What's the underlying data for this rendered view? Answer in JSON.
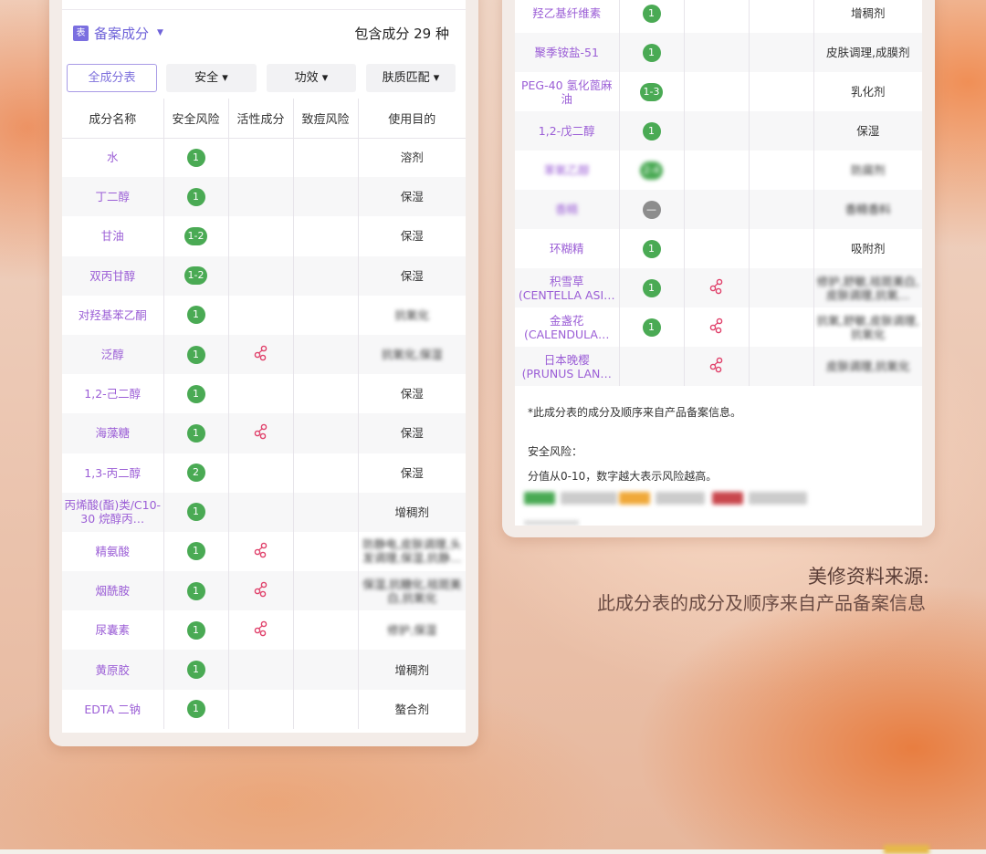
{
  "left": {
    "header": {
      "icon_label": "表",
      "title": "备案成分",
      "count_text": "包含成分 29 种"
    },
    "filters": [
      "全成分表",
      "安全 ▾",
      "功效 ▾",
      "肤质匹配 ▾"
    ],
    "columns": [
      "成分名称",
      "安全风险",
      "活性成分",
      "致痘风险",
      "使用目的"
    ],
    "rows": [
      {
        "name": "水",
        "risk": "1",
        "active": false,
        "purpose": "溶剂"
      },
      {
        "name": "丁二醇",
        "risk": "1",
        "active": false,
        "purpose": "保湿"
      },
      {
        "name": "甘油",
        "risk": "1-2",
        "active": false,
        "purpose": "保湿"
      },
      {
        "name": "双丙甘醇",
        "risk": "1-2",
        "active": false,
        "purpose": "保湿"
      },
      {
        "name": "对羟基苯乙酮",
        "risk": "1",
        "active": false,
        "purpose": "抗氧化"
      },
      {
        "name": "泛醇",
        "risk": "1",
        "active": true,
        "purpose": "抗氧化,保湿"
      },
      {
        "name": "1,2-己二醇",
        "risk": "1",
        "active": false,
        "purpose": "保湿"
      },
      {
        "name": "海藻糖",
        "risk": "1",
        "active": true,
        "purpose": "保湿"
      },
      {
        "name": "1,3-丙二醇",
        "risk": "2",
        "active": false,
        "purpose": "保湿"
      },
      {
        "name": "丙烯酸(酯)类/C10-30 烷醇丙…",
        "risk": "1",
        "active": false,
        "purpose": "增稠剂"
      },
      {
        "name": "精氨酸",
        "risk": "1",
        "active": true,
        "purpose": "防静电,皮肤调理,头发调理,保湿,抗静…"
      },
      {
        "name": "烟酰胺",
        "risk": "1",
        "active": true,
        "purpose": "保湿,抗糖化,祛斑美白,抗氧化"
      },
      {
        "name": "尿囊素",
        "risk": "1",
        "active": true,
        "purpose": "修护,保湿"
      },
      {
        "name": "黄原胶",
        "risk": "1",
        "active": false,
        "purpose": "增稠剂"
      },
      {
        "name": "EDTA 二钠",
        "risk": "1",
        "active": false,
        "purpose": "螯合剂"
      }
    ]
  },
  "right": {
    "rows": [
      {
        "name": "羟乙基纤维素",
        "risk": "1",
        "active": false,
        "purpose": "增稠剂"
      },
      {
        "name": "聚季铵盐-51",
        "risk": "1",
        "active": false,
        "purpose": "皮肤调理,成膜剂"
      },
      {
        "name": "PEG-40 氢化蓖麻油",
        "risk": "1-3",
        "active": false,
        "purpose": "乳化剂"
      },
      {
        "name": "1,2-戊二醇",
        "risk": "1",
        "active": false,
        "purpose": "保湿"
      },
      {
        "name": "苯氧乙醇",
        "risk": "2-4",
        "active": false,
        "purpose": "防腐剂"
      },
      {
        "name": "香精",
        "risk": "—",
        "active": false,
        "purpose": "香精香料"
      },
      {
        "name": "环糊精",
        "risk": "1",
        "active": false,
        "purpose": "吸附剂"
      },
      {
        "name": "积雪草 (CENTELLA ASI…",
        "risk": "1",
        "active": true,
        "purpose": "修护,舒敏,祛斑美白,皮肤调理,抗氧…"
      },
      {
        "name": "金盏花 (CALENDULA…",
        "risk": "1",
        "active": true,
        "purpose": "抗氧,舒敏,皮肤调理,抗氧化"
      },
      {
        "name": "日本晚樱 (PRUNUS LAN…",
        "risk": "",
        "active": true,
        "purpose": "皮肤调理,抗氧化"
      }
    ],
    "note": "*此成分表的成分及顺序来自产品备案信息。",
    "risk_title": "安全风险：",
    "risk_desc": "分值从0-10，数字越大表示风险越高。",
    "legend_colors": [
      "#4aaa54",
      "#f0a93a",
      "#c9474d"
    ]
  },
  "source": {
    "title": "美修资料来源:",
    "body": "此成分表的成分及顺序来自产品备案信息"
  }
}
